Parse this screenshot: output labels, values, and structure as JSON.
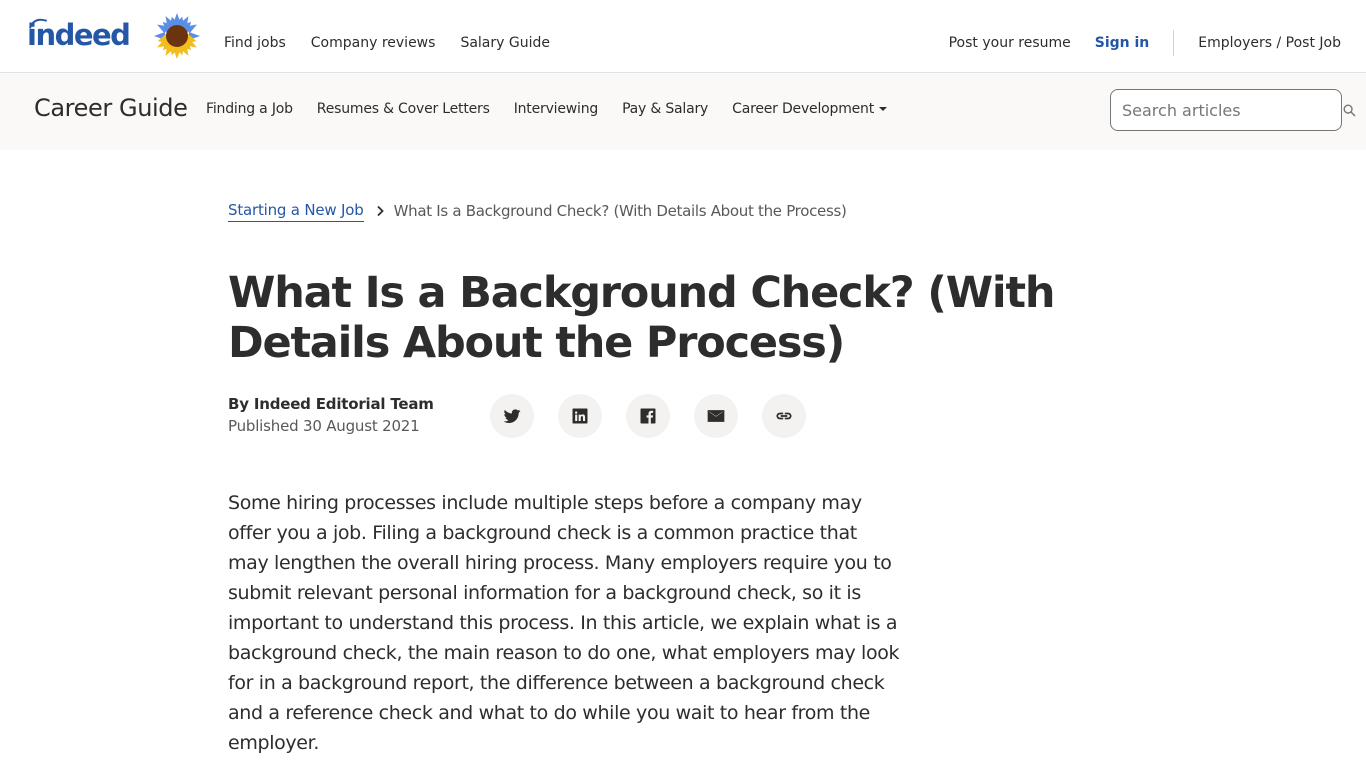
{
  "header": {
    "logo_text": "indeed",
    "nav_left": [
      "Find jobs",
      "Company reviews",
      "Salary Guide"
    ],
    "nav_right": {
      "post_resume": "Post your resume",
      "sign_in": "Sign in",
      "employers": "Employers / Post Job"
    }
  },
  "guide": {
    "title": "Career Guide",
    "nav": [
      "Finding a Job",
      "Resumes & Cover Letters",
      "Interviewing",
      "Pay & Salary",
      "Career Development"
    ],
    "search_placeholder": "Search articles"
  },
  "breadcrumb": {
    "parent": "Starting a New Job",
    "current": "What Is a Background Check? (With Details About the Process)"
  },
  "article": {
    "title": "What Is a Background Check? (With Details About the Process)",
    "author": "By Indeed Editorial Team",
    "published": "Published 30 August 2021",
    "share_icons": [
      "twitter-icon",
      "linkedin-icon",
      "facebook-icon",
      "email-icon",
      "link-icon"
    ],
    "body_lines": [
      "Some hiring processes include multiple steps before a company may",
      "offer you a job. Filing a background check is a common practice that",
      "may lengthen the overall hiring process. Many employers require you to",
      "submit relevant personal information for a background check, so it is",
      "important to understand this process. In this article, we explain what is a",
      "background check, the main reason to do one, what employers may look",
      "for in a background report, the difference between a background check",
      "and a reference check and what to do while you wait to hear from the",
      "employer."
    ]
  },
  "colors": {
    "brand_blue": "#2557a7",
    "text": "#2d2d2d",
    "muted": "#595959",
    "guide_bg": "#faf9f8",
    "share_bg": "#f3f2f1"
  }
}
